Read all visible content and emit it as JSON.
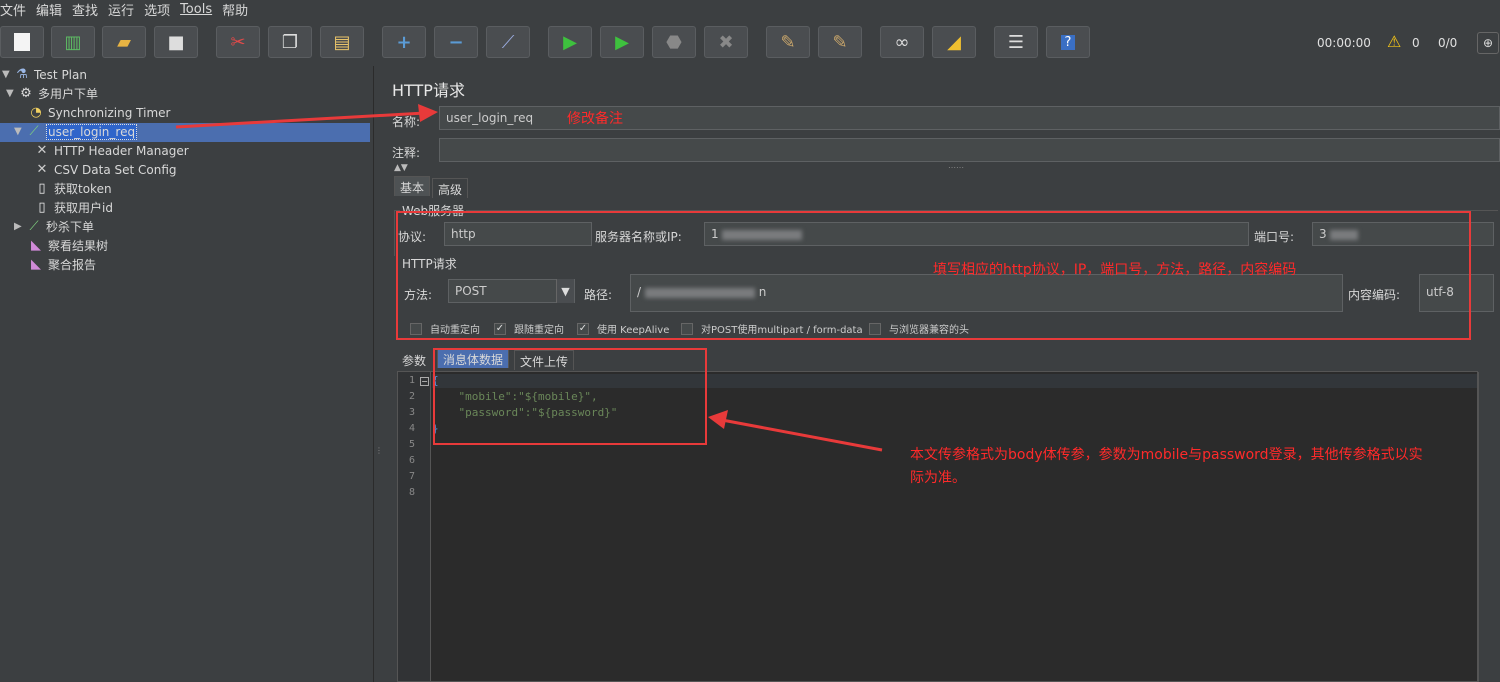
{
  "menu": [
    "文件",
    "编辑",
    "查找",
    "运行",
    "选项",
    "Tools",
    "帮助"
  ],
  "toolbar": {
    "timer": "00:00:00",
    "warning_count": "0",
    "thread_ratio": "0/0"
  },
  "tree": [
    {
      "label": "Test Plan",
      "icon": "test-plan-icon"
    },
    {
      "label": "多用户下单",
      "icon": "thread-group-icon"
    },
    {
      "label": "Synchronizing Timer",
      "icon": "timer-icon"
    },
    {
      "label": "user_login_req",
      "icon": "sampler-icon"
    },
    {
      "label": "HTTP Header Manager",
      "icon": "config-icon"
    },
    {
      "label": "CSV Data Set Config",
      "icon": "config-icon"
    },
    {
      "label": "获取token",
      "icon": "extractor-icon"
    },
    {
      "label": "获取用户id",
      "icon": "extractor-icon"
    },
    {
      "label": "秒杀下单",
      "icon": "sampler-icon"
    },
    {
      "label": "察看结果树",
      "icon": "listener-icon"
    },
    {
      "label": "聚合报告",
      "icon": "listener-icon"
    }
  ],
  "panel": {
    "title": "HTTP请求",
    "name_label": "名称:",
    "name_value": "user_login_req",
    "comment_label": "注释:",
    "tabs": [
      "基本",
      "高级"
    ],
    "web_server_legend": "Web服务器",
    "protocol_label": "协议:",
    "protocol_value": "http",
    "server_label": "服务器名称或IP:",
    "server_value": "1",
    "port_label": "端口号:",
    "port_value": "3",
    "http_request_legend": "HTTP请求",
    "method_label": "方法:",
    "method_value": "POST",
    "path_label": "路径:",
    "path_prefix": "/",
    "path_suffix": "n",
    "encoding_label": "内容编码:",
    "encoding_value": "utf-8",
    "checkboxes": [
      {
        "label": "自动重定向",
        "checked": false
      },
      {
        "label": "跟随重定向",
        "checked": true
      },
      {
        "label": "使用 KeepAlive",
        "checked": true
      },
      {
        "label": "对POST使用multipart / form-data",
        "checked": false
      },
      {
        "label": "与浏览器兼容的头",
        "checked": false
      }
    ],
    "body_tabs": [
      "参数",
      "消息体数据",
      "文件上传"
    ],
    "code_lines": [
      "{",
      "    \"mobile\":\"${mobile}\",",
      "    \"password\":\"${password}\"",
      "}",
      "",
      "",
      "",
      ""
    ]
  },
  "annotations": {
    "name_note": "修改备注",
    "server_note": "填写相应的http协议，IP，端口号，方法，路径，内容编码",
    "body_note_line1": "本文传参格式为body体传参，参数为mobile与password登录，其他传参格式以实",
    "body_note_line2": "际为准。"
  },
  "colors": {
    "background": "#3c3f41",
    "selection": "#4b6eaf",
    "annotation_red": "#e83a3a",
    "code_green": "#6a8759"
  }
}
